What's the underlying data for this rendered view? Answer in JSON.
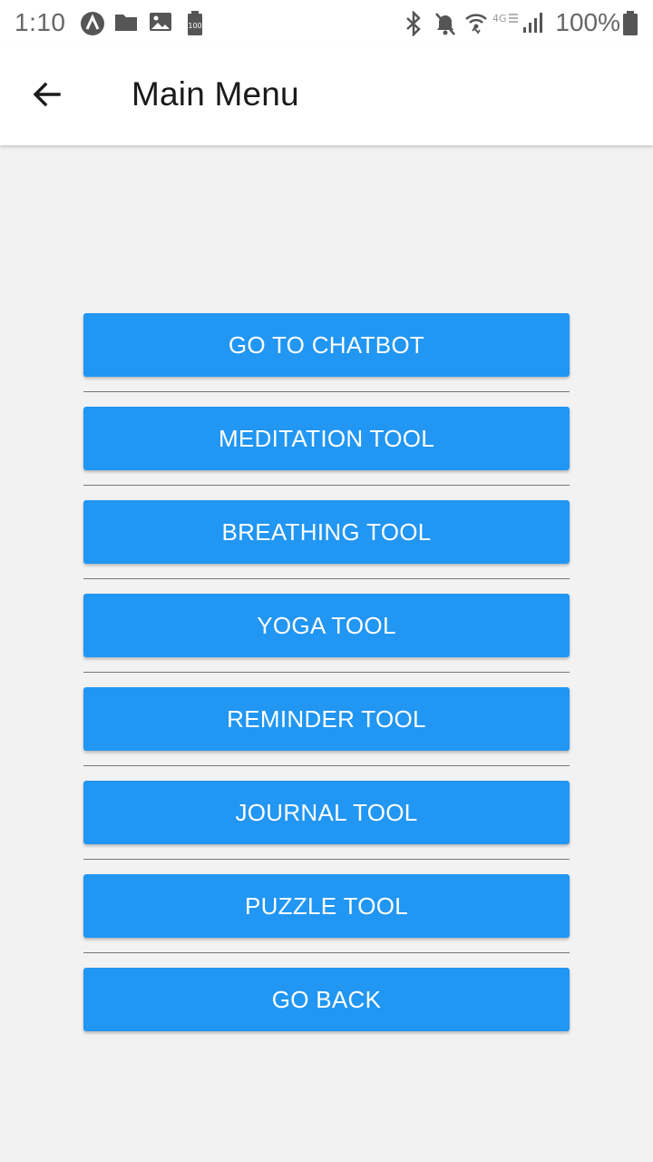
{
  "status_bar": {
    "time": "1:10",
    "battery_small_label": "100",
    "battery_percent": "100%",
    "left_icons": [
      "app-icon",
      "folder-icon",
      "image-icon",
      "battery-saver-icon"
    ],
    "right_icons": [
      "bluetooth-icon",
      "mute-icon",
      "wifi-icon",
      "lte-icon",
      "signal-icon",
      "battery-icon"
    ]
  },
  "app_bar": {
    "title": "Main Menu"
  },
  "menu": {
    "items": [
      {
        "label": "GO TO CHATBOT"
      },
      {
        "label": "MEDITATION TOOL"
      },
      {
        "label": "BREATHING TOOL"
      },
      {
        "label": "YOGA TOOL"
      },
      {
        "label": "REMINDER TOOL"
      },
      {
        "label": "JOURNAL TOOL"
      },
      {
        "label": "PUZZLE TOOL"
      },
      {
        "label": "GO BACK"
      }
    ]
  },
  "colors": {
    "button": "#2196f3",
    "background": "#f2f2f2",
    "app_bar": "#ffffff"
  }
}
